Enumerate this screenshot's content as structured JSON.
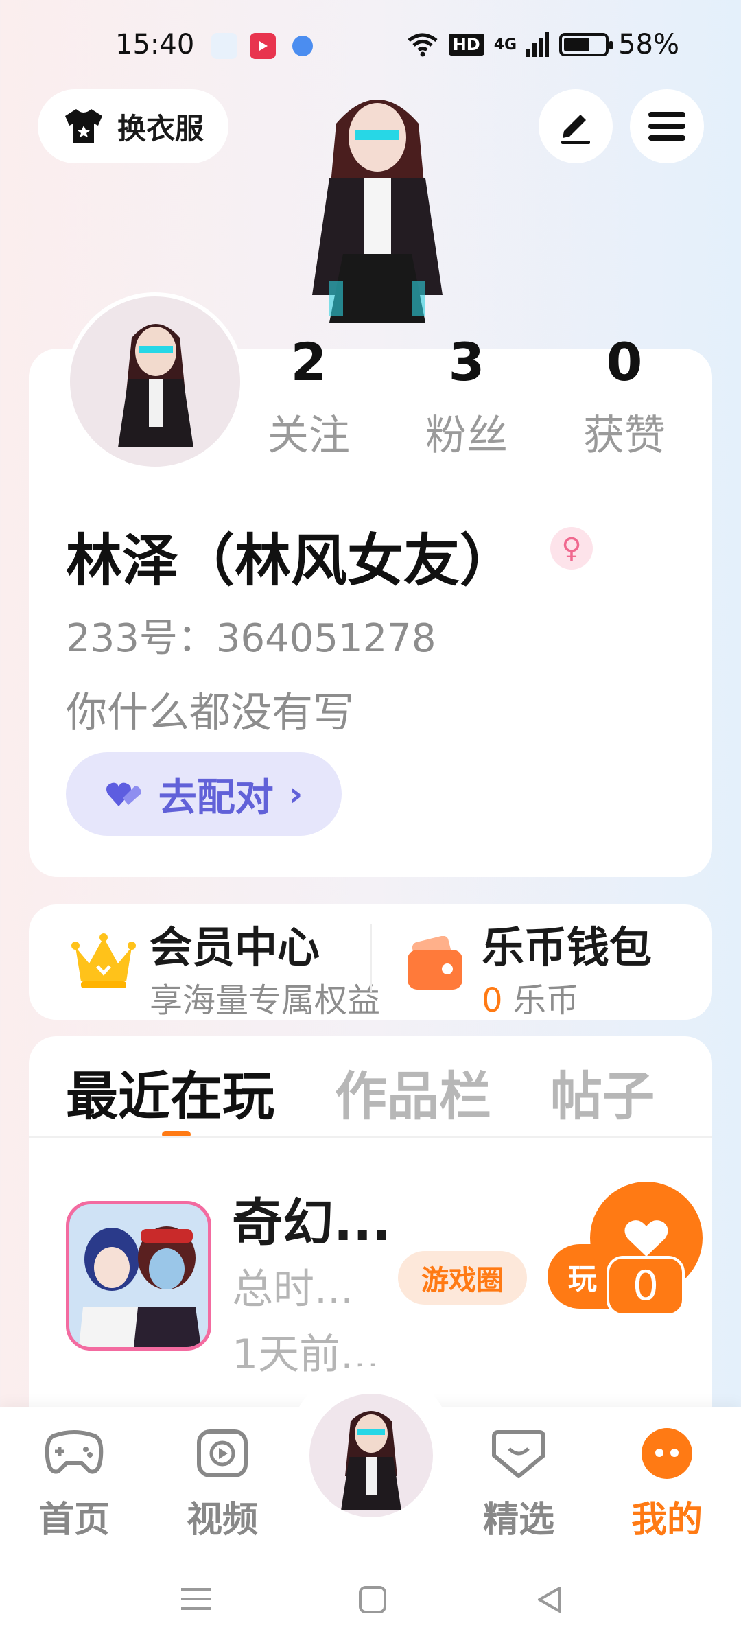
{
  "status_bar": {
    "time": "15:40",
    "network": "HD",
    "signal": "4G",
    "battery": "58%"
  },
  "header": {
    "outfit_label": "换衣服",
    "edit_icon": "pen-icon",
    "menu_icon": "hamburger-icon"
  },
  "profile": {
    "stats": [
      {
        "value": "2",
        "label": "关注"
      },
      {
        "value": "3",
        "label": "粉丝"
      },
      {
        "value": "0",
        "label": "获赞"
      }
    ],
    "nickname": "林泽（林风女友）",
    "gender_symbol": "♀",
    "uid": "233号：364051278",
    "bio": "你什么都没有写",
    "match_label": "去配对",
    "match_arrow": "›"
  },
  "member": {
    "title": "会员中心",
    "subtitle": "享海量专属权益"
  },
  "wallet": {
    "title": "乐币钱包",
    "amount": "0",
    "unit": "乐币"
  },
  "tabs": [
    {
      "label": "最近在玩",
      "active": true
    },
    {
      "label": "作品栏",
      "active": false
    },
    {
      "label": "帖子",
      "active": false
    }
  ],
  "recent_game": {
    "title": "奇幻...",
    "total_time": "总时...",
    "last_played": "1天前...",
    "circle_button": "游戏圈",
    "play_button": "玩",
    "like_count": "0"
  },
  "bottom_nav": [
    {
      "label": "首页",
      "icon": "gamepad-icon"
    },
    {
      "label": "视频",
      "icon": "video-icon"
    },
    {
      "label": "精选",
      "icon": "heart-chat-icon"
    },
    {
      "label": "我的",
      "icon": "profile-face-icon",
      "active": true
    }
  ],
  "colors": {
    "accent": "#ff7a14",
    "match_bg": "#e6e6fb",
    "match_text": "#6161d8"
  }
}
